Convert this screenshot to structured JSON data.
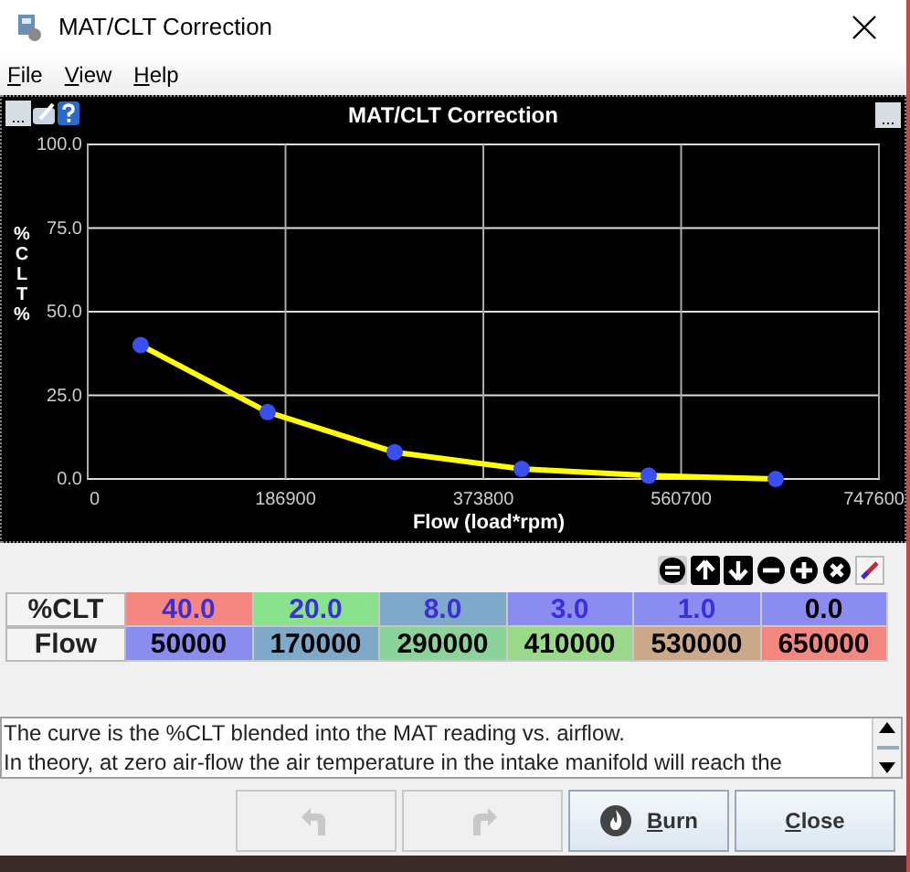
{
  "window": {
    "title": "MAT/CLT Correction"
  },
  "menu": [
    {
      "label": "File"
    },
    {
      "label": "View"
    },
    {
      "label": "Help"
    }
  ],
  "chart_panel": {
    "title": "MAT/CLT Correction",
    "left_button": "...",
    "right_button": "...",
    "chart_data": {
      "type": "line",
      "xlabel": "Flow (load*rpm)",
      "ylabel": "%CLT %",
      "grid": true,
      "x": [
        50000,
        170000,
        290000,
        410000,
        530000,
        650000
      ],
      "series": [
        {
          "color": "#ffff00",
          "marker": "circle",
          "values": [
            40.0,
            20.0,
            8.0,
            3.0,
            1.0,
            0.0
          ]
        }
      ],
      "xlim": [
        0,
        747600
      ],
      "ylim": [
        0,
        100
      ],
      "xticks": [
        0,
        186900,
        373800,
        560700,
        747600
      ],
      "yticks": [
        {
          "value": 0,
          "label": "0.0"
        },
        {
          "value": 25,
          "label": "25.0"
        },
        {
          "value": 50,
          "label": "50.0"
        },
        {
          "value": 75,
          "label": "75.0"
        },
        {
          "value": 100,
          "label": "100.0"
        }
      ]
    }
  },
  "table": {
    "rows": [
      {
        "header": "%CLT",
        "cells": [
          {
            "value": "40.0",
            "color": "#f4877f",
            "highlighted": true
          },
          {
            "value": "20.0",
            "color": "#8ae38c",
            "highlighted": true
          },
          {
            "value": "8.0",
            "color": "#7fa9c9",
            "highlighted": true
          },
          {
            "value": "3.0",
            "color": "#8b8cf0",
            "highlighted": true
          },
          {
            "value": "1.0",
            "color": "#8b8cf0",
            "highlighted": true
          },
          {
            "value": "0.0",
            "color": "#8b8cf0",
            "highlighted": false
          }
        ]
      },
      {
        "header": "Flow",
        "cells": [
          {
            "value": "50000",
            "color": "#8b8cf0",
            "highlighted": false
          },
          {
            "value": "170000",
            "color": "#7fa9c9",
            "highlighted": false
          },
          {
            "value": "290000",
            "color": "#8ad39a",
            "highlighted": false
          },
          {
            "value": "410000",
            "color": "#9ad98a",
            "highlighted": false
          },
          {
            "value": "530000",
            "color": "#caa98a",
            "highlighted": false
          },
          {
            "value": "650000",
            "color": "#f4877f",
            "highlighted": false
          }
        ]
      }
    ]
  },
  "description": [
    "The curve is the %CLT blended into the MAT reading vs. airflow.",
    "In theory, at zero air-flow the air temperature in the intake manifold will reach the"
  ],
  "buttons": [
    {
      "kind": "undo",
      "disabled": true
    },
    {
      "kind": "redo",
      "disabled": true
    },
    {
      "kind": "burn",
      "label": "Burn",
      "disabled": false
    },
    {
      "kind": "close",
      "label": "Close",
      "disabled": false
    }
  ]
}
